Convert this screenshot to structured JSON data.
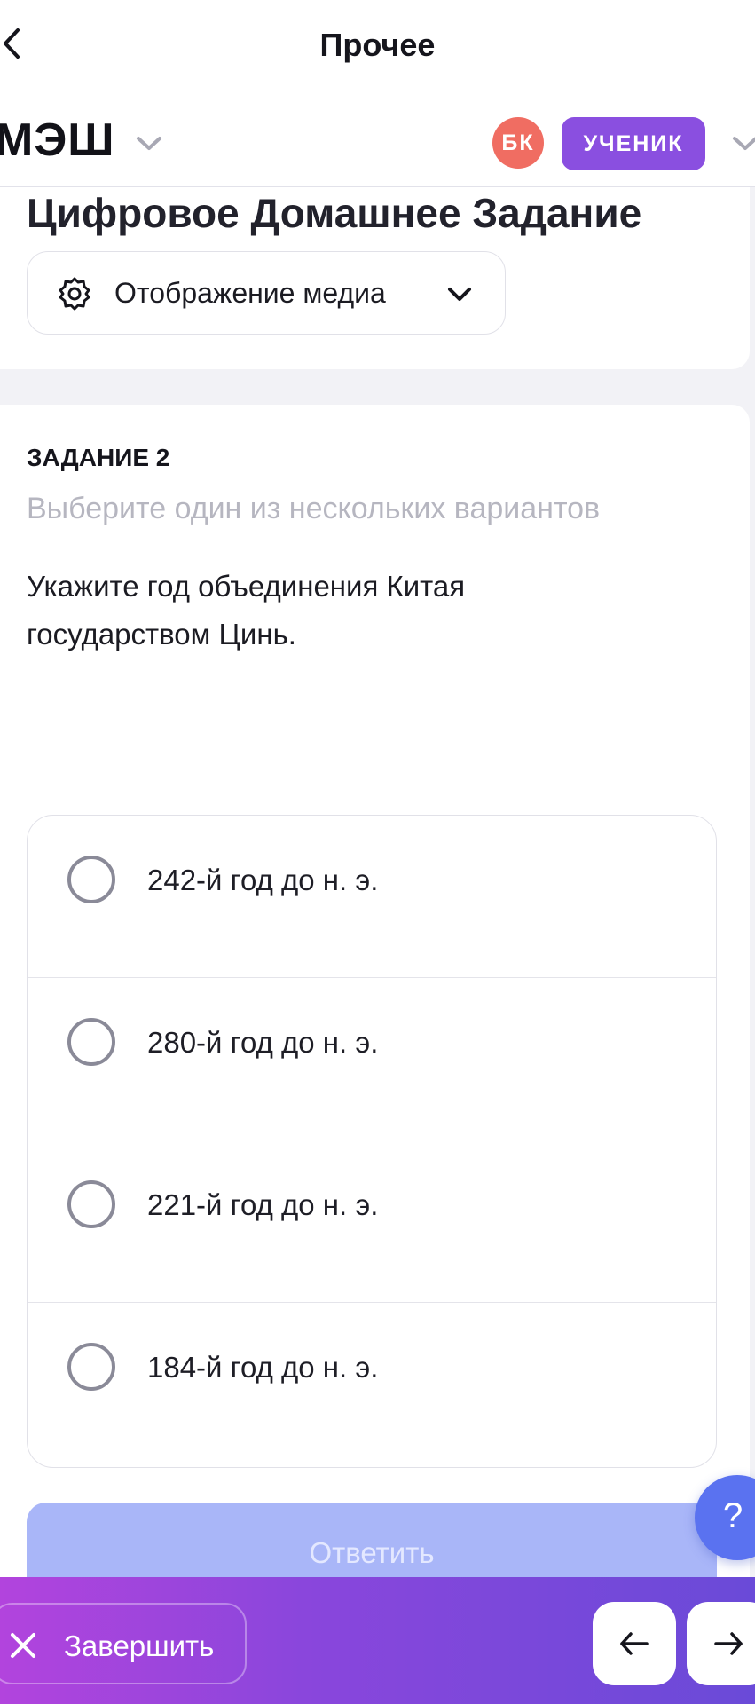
{
  "topbar": {
    "title": "Прочее"
  },
  "header": {
    "logo": "МЭШ",
    "avatar_initials": "БК",
    "role": "УЧЕНИК"
  },
  "page": {
    "heading": "Цифровое Домашнее Задание",
    "media_button": "Отображение медиа"
  },
  "task": {
    "number": "ЗАДАНИЕ 2",
    "hint": "Выберите один из нескольких вариантов",
    "question": "Укажите год объединения Китая государством Цинь.",
    "options": [
      {
        "label": "242-й год до н. э."
      },
      {
        "label": "280-й год до н. э."
      },
      {
        "label": "221-й год до н. э."
      },
      {
        "label": "184-й год до н. э."
      }
    ],
    "submit_label": "Ответить"
  },
  "help": {
    "label": "?"
  },
  "footer": {
    "finish_label": "Завершить"
  },
  "icons": [
    "back-icon",
    "chevron-down-icon",
    "gear-icon",
    "close-icon",
    "arrow-left-icon",
    "arrow-right-icon"
  ],
  "colors": {
    "accent": "#8a4fe0",
    "avatar": "#f06d62",
    "help": "#5a72f0",
    "submit_disabled": "#a9b6f8"
  }
}
